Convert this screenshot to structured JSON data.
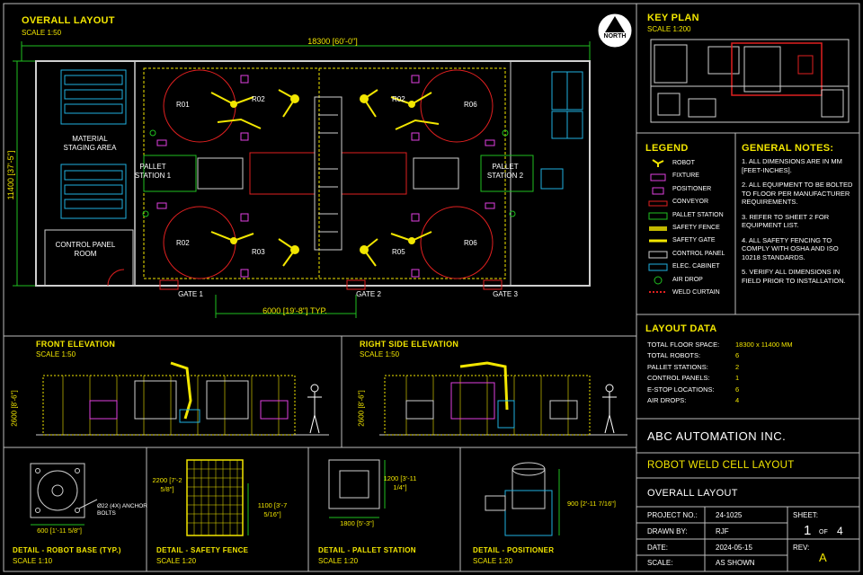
{
  "overall": {
    "title": "OVERALL LAYOUT",
    "scale": "SCALE 1:50",
    "width_dim": "18300 [60'-0\"]",
    "height_dim": "11400 [37'-5\"]",
    "bay_dim": "6000 [19'-8\"]   TYP.",
    "north": "NORTH",
    "staging": "MATERIAL STAGING AREA",
    "control_room": "CONTROL PANEL ROOM",
    "pallet1": "PALLET STATION 1",
    "pallet2": "PALLET STATION 2",
    "robots": [
      "R01",
      "R02",
      "R02",
      "R06",
      "R02",
      "R03",
      "R05",
      "R06"
    ],
    "gates": [
      "GATE 1",
      "GATE 2",
      "GATE 3"
    ]
  },
  "keyplan": {
    "title": "KEY PLAN",
    "scale": "SCALE 1:200"
  },
  "legend": {
    "title": "LEGEND",
    "items": [
      {
        "label": "ROBOT",
        "color": "#f2e600"
      },
      {
        "label": "FIXTURE",
        "color": "#e040e0"
      },
      {
        "label": "POSITIONER",
        "color": "#e040e0"
      },
      {
        "label": "CONVEYOR",
        "color": "#e02020"
      },
      {
        "label": "PALLET STATION",
        "color": "#20c020"
      },
      {
        "label": "SAFETY FENCE",
        "color": "#f2e600"
      },
      {
        "label": "SAFETY GATE",
        "color": "#f2e600"
      },
      {
        "label": "CONTROL PANEL",
        "color": "#cfcfcf"
      },
      {
        "label": "ELEC. CABINET",
        "color": "#20b0e0"
      },
      {
        "label": "AIR DROP",
        "color": "#20c020"
      },
      {
        "label": "WELD CURTAIN",
        "color": "#e02020"
      }
    ]
  },
  "notes": {
    "title": "GENERAL NOTES:",
    "items": [
      "1.  ALL DIMENSIONS ARE IN MM [FEET-INCHES].",
      "2.  ALL EQUIPMENT TO BE BOLTED TO FLOOR PER MANUFACTURER REQUIREMENTS.",
      "3.  REFER TO SHEET 2 FOR EQUIPMENT LIST.",
      "4.  ALL SAFETY FENCING TO COMPLY WITH OSHA AND ISO 10218 STANDARDS.",
      "5.  VERIFY ALL DIMENSIONS IN FIELD PRIOR TO INSTALLATION."
    ]
  },
  "layout_data": {
    "title": "LAYOUT DATA",
    "rows": [
      {
        "label": "TOTAL FLOOR SPACE:",
        "value": "18300 x 11400 MM"
      },
      {
        "label": "TOTAL ROBOTS:",
        "value": "6"
      },
      {
        "label": "PALLET STATIONS:",
        "value": "2"
      },
      {
        "label": "CONTROL PANELS:",
        "value": "1"
      },
      {
        "label": "E-STOP LOCATIONS:",
        "value": "6"
      },
      {
        "label": "AIR DROPS:",
        "value": "4"
      }
    ]
  },
  "front_elev": {
    "title": "FRONT ELEVATION",
    "scale": "SCALE 1:50",
    "height": "2600 [8'-6\"]"
  },
  "side_elev": {
    "title": "RIGHT SIDE ELEVATION",
    "scale": "SCALE 1:50",
    "height": "2600 [8'-6\"]"
  },
  "details": {
    "robot_base": {
      "title": "DETAIL - ROBOT BASE (TYP.)",
      "scale": "SCALE  1:10",
      "bolts": "Ø22 (4X) ANCHOR BOLTS",
      "dim": "600 [1'-11 5/8\"]"
    },
    "fence": {
      "title": "DETAIL - SAFETY FENCE",
      "scale": "SCALE  1:20",
      "dim_h": "2200 [7'-2 5/8\"]",
      "dim_w": "1100 [3'-7 5/16\"]"
    },
    "pallet": {
      "title": "DETAIL - PALLET STATION",
      "scale": "SCALE  1:20",
      "dim_w": "1200 [3'-11 1/4\"]",
      "dim_b": "1800 [5'-3\"]"
    },
    "positioner": {
      "title": "DETAIL - POSITIONER",
      "scale": "SCALE  1:20",
      "dim": "900 [2'-11 7/16\"]"
    }
  },
  "titleblock": {
    "company": "ABC AUTOMATION INC.",
    "project_title": "ROBOT WELD CELL LAYOUT",
    "drawing_title": "OVERALL LAYOUT",
    "project_no_label": "PROJECT NO.:",
    "project_no": "24-1025",
    "drawn_by_label": "DRAWN BY:",
    "drawn_by": "RJF",
    "date_label": "DATE:",
    "date": "2024-05-15",
    "scale_label": "SCALE:",
    "scale": "AS SHOWN",
    "sheet_label": "SHEET:",
    "sheet": "1",
    "of": "OF",
    "sheet_total": "4",
    "rev_label": "REV:",
    "rev": "A"
  }
}
